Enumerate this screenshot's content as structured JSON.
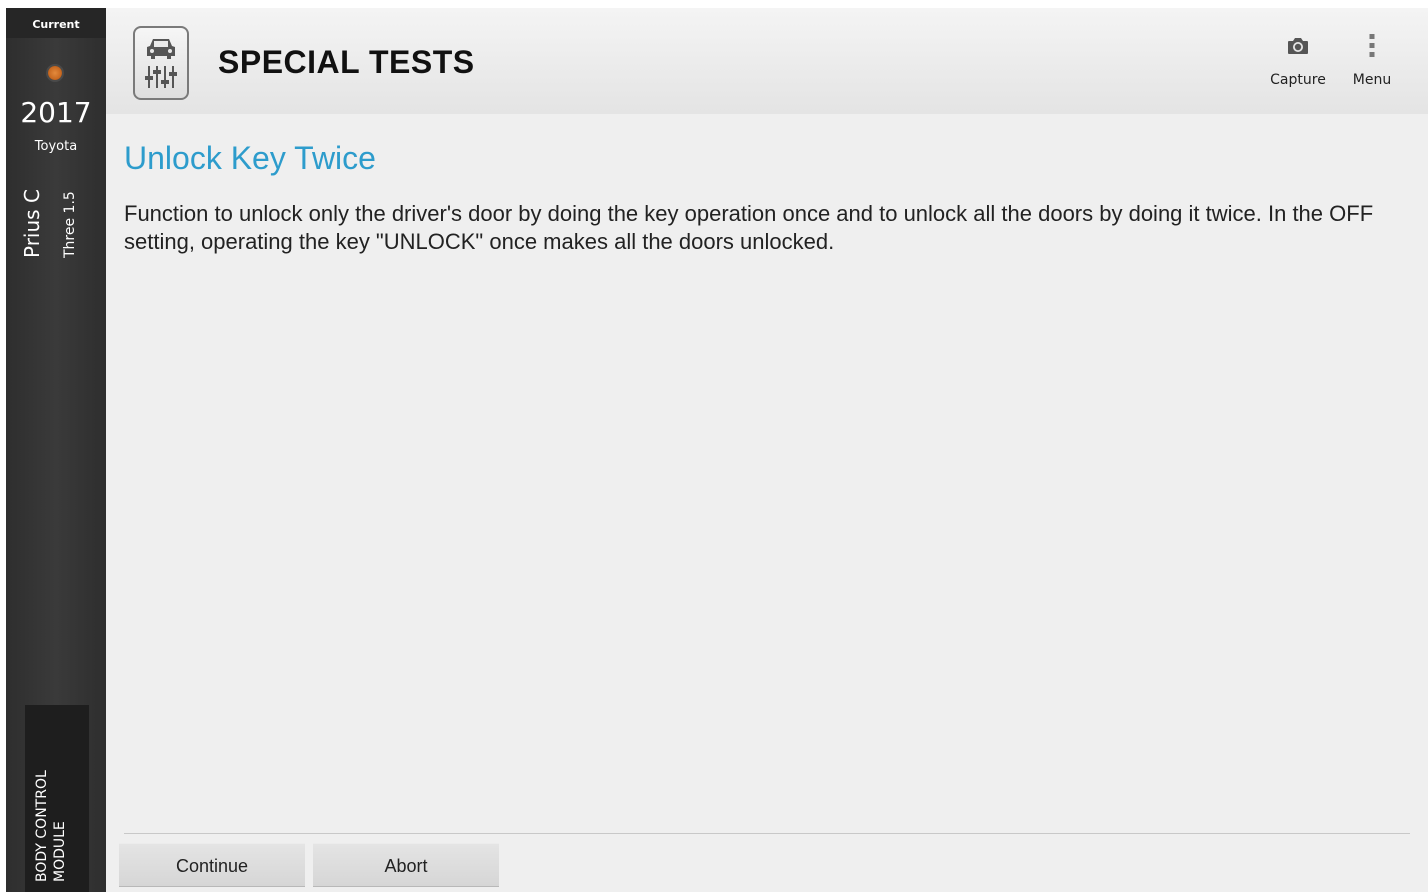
{
  "sidebar": {
    "current_label": "Current",
    "year": "2017",
    "make": "Toyota",
    "model": "Prius C",
    "trim": "Three 1.5",
    "module": "BODY CONTROL MODULE",
    "status_dot_color": "#d47a2e"
  },
  "header": {
    "title": "SPECIAL TESTS",
    "icon": "car-adjust-icon",
    "capture_label": "Capture",
    "menu_label": "Menu"
  },
  "main": {
    "test_title": "Unlock Key Twice",
    "description": "Function to unlock only the driver's door by doing the key operation once and to unlock all the doors by doing it twice. In the OFF setting, operating the key \"UNLOCK\" once makes all the doors unlocked.",
    "title_color": "#2d9ccc"
  },
  "actions": {
    "continue_label": "Continue",
    "abort_label": "Abort"
  }
}
